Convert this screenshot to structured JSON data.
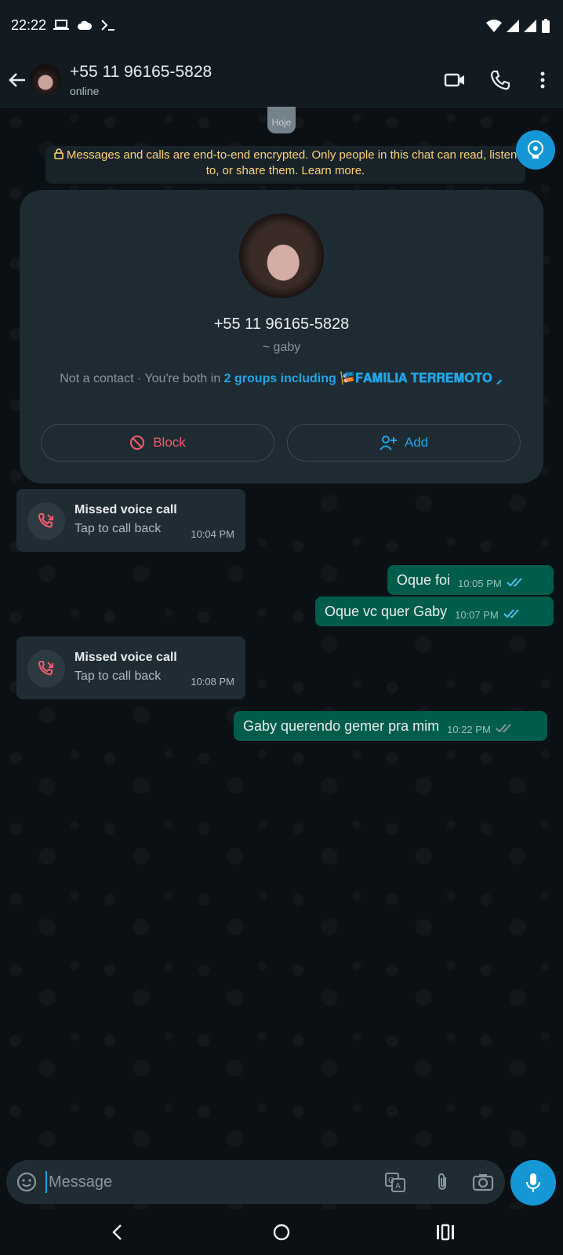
{
  "status_bar": {
    "time": "22:22",
    "left_icons": [
      "laptop-icon",
      "cloud-icon",
      "terminal-icon"
    ],
    "right_icons": [
      "wifi-icon",
      "signal-icon",
      "signal-icon",
      "battery-icon"
    ]
  },
  "header": {
    "name": "+55 11 96165-5828",
    "status": "online",
    "icons": [
      "back-arrow-icon",
      "video-call-icon",
      "voice-call-icon",
      "more-vert-icon"
    ]
  },
  "date_chip": "Hoje",
  "encryption_notice": "Messages and calls are end-to-end encrypted. Only people in this chat can read, listen to, or share them. Learn more.",
  "contact_card": {
    "phone": "+55 11 96165-5828",
    "nickname": "~ gaby",
    "info_prefix": "Not a contact · You're both in",
    "groups_link": "2 groups including 🎏𝐅𝐀𝐌𝐈́𝐋𝐈𝐀 𝐓𝐄𝐑𝐑𝐄𝐌𝐎𝐓𝐎 ⸝",
    "block_label": "Block",
    "add_label": "Add"
  },
  "messages": [
    {
      "type": "missed_call",
      "title": "Missed voice call",
      "subtitle": "Tap to call back",
      "time": "10:04 PM"
    },
    {
      "type": "out",
      "text": "Oque foi",
      "time": "10:05 PM",
      "status": "read"
    },
    {
      "type": "out",
      "text": "Oque vc quer Gaby",
      "time": "10:07 PM",
      "status": "read"
    },
    {
      "type": "missed_call",
      "title": "Missed voice call",
      "subtitle": "Tap to call back",
      "time": "10:08 PM"
    },
    {
      "type": "out",
      "text": "Gaby querendo gemer pra mim",
      "time": "10:22 PM",
      "status": "delivered"
    }
  ],
  "composer": {
    "placeholder": "Message",
    "icons": [
      "sticker-icon",
      "translate-icon",
      "attach-icon",
      "camera-icon",
      "mic-icon"
    ]
  },
  "colors": {
    "header_bg": "#111b21",
    "outgoing_bubble": "#005c4b",
    "incoming_bubble": "#202c33",
    "accent": "#1597d6",
    "read_ticks": "#53bdeb",
    "notice_text": "#ffd279",
    "block_red": "#f15c6d"
  },
  "nav_bar": {
    "icons": [
      "nav-back-icon",
      "nav-home-icon",
      "nav-recents-icon"
    ]
  }
}
